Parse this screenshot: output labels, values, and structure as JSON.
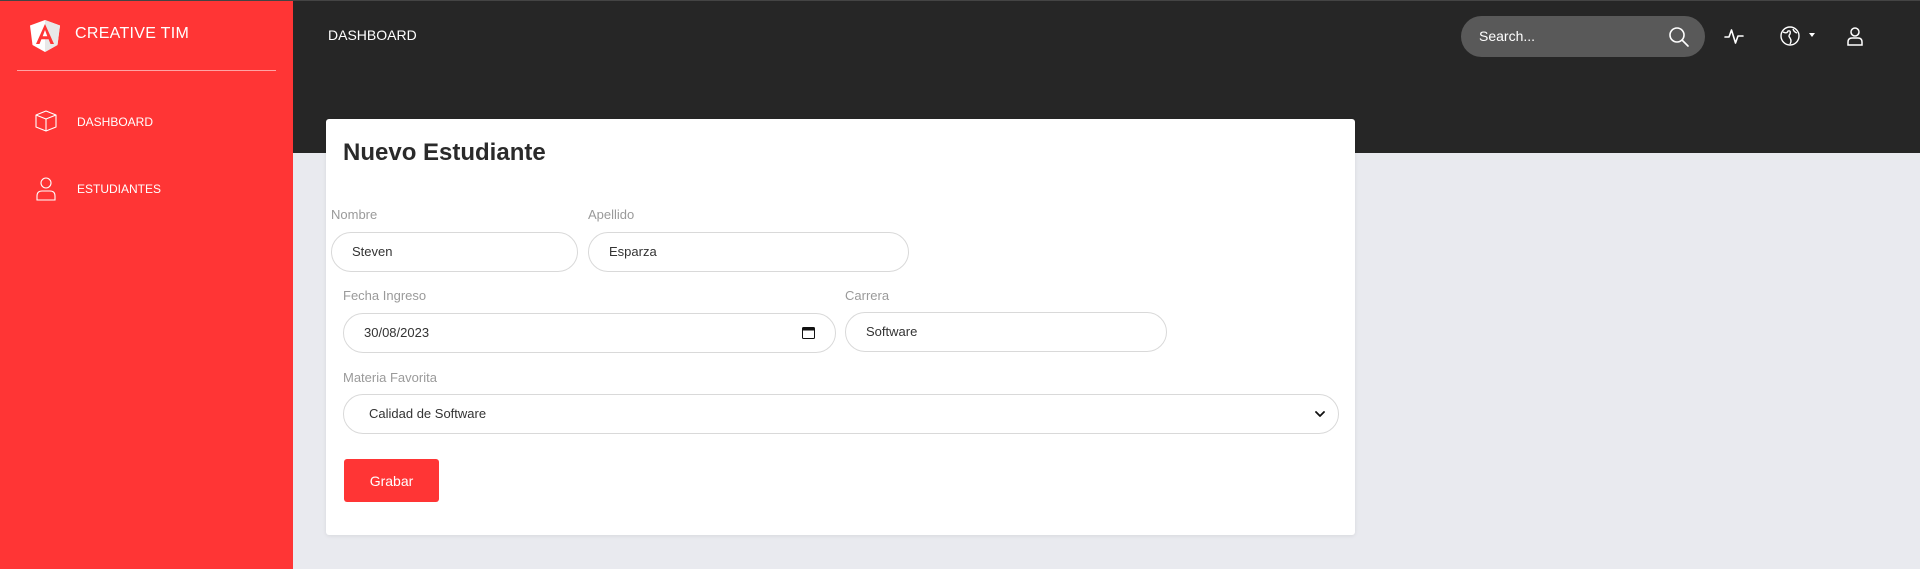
{
  "brand": {
    "name": "CREATIVE TIM",
    "logo_icon": "angular-logo-icon"
  },
  "sidebar": {
    "items": [
      {
        "label": "DASHBOARD",
        "icon": "cube-icon"
      },
      {
        "label": "ESTUDIANTES",
        "icon": "user-icon"
      }
    ]
  },
  "topbar": {
    "title": "DASHBOARD",
    "search_placeholder": "Search...",
    "icons": [
      "search-icon",
      "activity-icon",
      "globe-icon",
      "user-icon"
    ]
  },
  "form": {
    "title": "Nuevo Estudiante",
    "nombre_label": "Nombre",
    "nombre_value": "Steven",
    "apellido_label": "Apellido",
    "apellido_value": "Esparza",
    "fecha_label": "Fecha Ingreso",
    "fecha_value": "30/08/2023",
    "carrera_label": "Carrera",
    "carrera_value": "Software",
    "materia_label": "Materia Favorita",
    "materia_value": "Calidad de Software",
    "submit_label": "Grabar"
  },
  "colors": {
    "accent": "#ff3535",
    "topbar": "#262626",
    "background": "#e9eaef"
  }
}
